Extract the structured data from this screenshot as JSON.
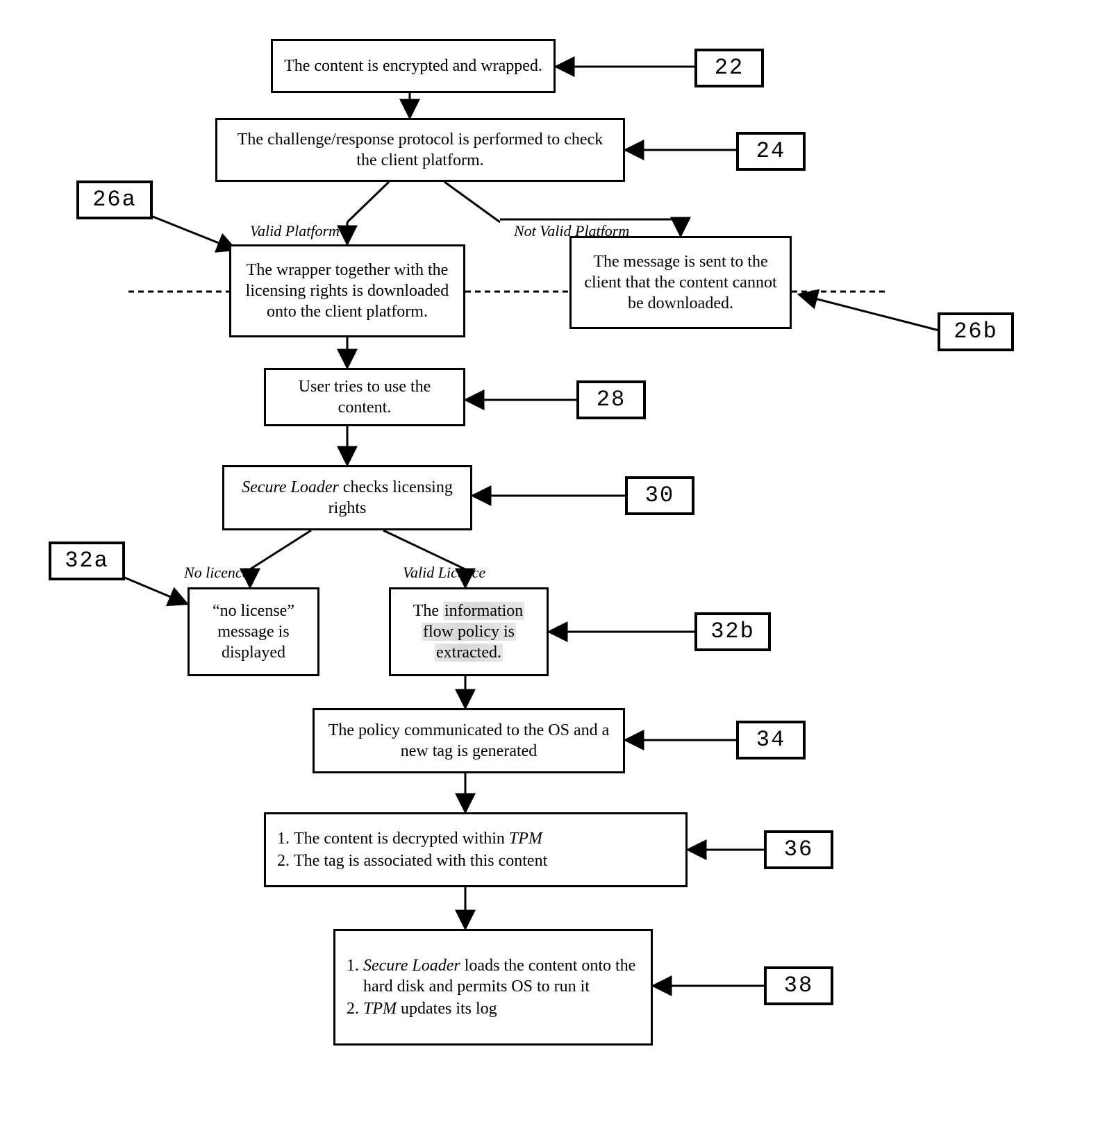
{
  "labels": {
    "n22": "22",
    "n24": "24",
    "n26a": "26a",
    "n26b": "26b",
    "n28": "28",
    "n30": "30",
    "n32a": "32a",
    "n32b": "32b",
    "n34": "34",
    "n36": "36",
    "n38": "38"
  },
  "edges": {
    "valid_platform": "Valid Platform",
    "not_valid_platform": "Not Valid Platform",
    "no_licence": "No licence",
    "valid_licence": "Valid Licence"
  },
  "boxes": {
    "b22": "The content is encrypted and wrapped.",
    "b24": "The challenge/response protocol is performed to check the client platform.",
    "b26a": "The wrapper together with the licensing rights is downloaded onto the client platform.",
    "b26b": "The message is sent to the client that the content cannot be downloaded.",
    "b28": "User tries to use the content.",
    "b30_pre": "Secure Loader",
    "b30_post": " checks licensing rights",
    "b32a": "“no license” message is displayed",
    "b32b_pre": "The ",
    "b32b_mid1": "information",
    "b32b_mid2": "flow policy is",
    "b32b_mid3": "extracted.",
    "b34": "The policy communicated to the OS and a new tag is generated",
    "b36_li1_pre": "The content is decrypted within ",
    "b36_li1_em": "TPM",
    "b36_li2": "The tag is associated with this content",
    "b38_li1_em": "Secure Loader",
    "b38_li1_post": " loads the content onto the hard disk and permits OS to run it",
    "b38_li2_em": "TPM",
    "b38_li2_post": " updates its log"
  }
}
